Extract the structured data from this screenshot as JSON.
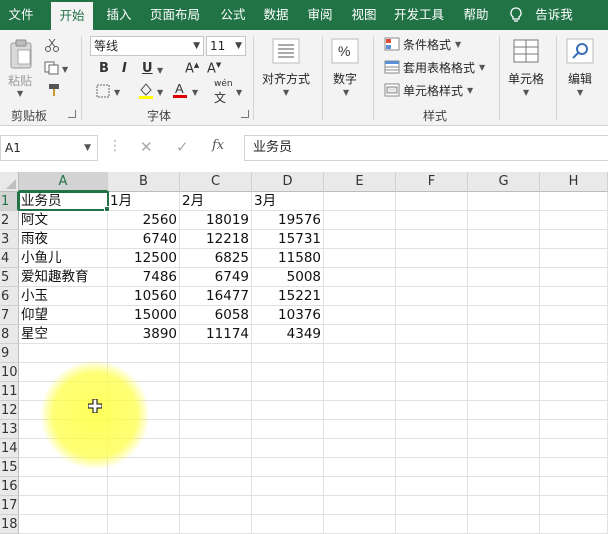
{
  "ribbon_tabs": [
    "文件",
    "开始",
    "插入",
    "页面布局",
    "公式",
    "数据",
    "审阅",
    "视图",
    "开发工具",
    "帮助",
    "告诉我"
  ],
  "active_tab": "开始",
  "clipboard": {
    "paste_label": "粘贴",
    "group_label": "剪贴板"
  },
  "font": {
    "font_name": "等线",
    "font_size": "11",
    "group_label": "字体",
    "phonetic_label": "wén"
  },
  "alignment": {
    "label": "对齐方式"
  },
  "number": {
    "label": "数字",
    "symbol": "%"
  },
  "styles": {
    "conditional_format": "条件格式",
    "table_format": "套用表格格式",
    "cell_styles": "单元格样式",
    "group_label": "样式"
  },
  "cells_group": {
    "label": "单元格"
  },
  "editing_group": {
    "label": "编辑"
  },
  "formula_bar": {
    "name_box": "A1",
    "fx": "fx",
    "content": "业务员"
  },
  "columns": [
    "A",
    "B",
    "C",
    "D",
    "E",
    "F",
    "G",
    "H"
  ],
  "rows": [
    "1",
    "2",
    "3",
    "4",
    "5",
    "6",
    "7",
    "8",
    "9",
    "10",
    "11",
    "12",
    "13",
    "14",
    "15",
    "16",
    "17",
    "18"
  ],
  "table": {
    "headers": [
      "业务员",
      "1月",
      "2月",
      "3月"
    ],
    "data": [
      [
        "阿文",
        "2560",
        "18019",
        "19576"
      ],
      [
        "雨夜",
        "6740",
        "12218",
        "15731"
      ],
      [
        "小鱼儿",
        "12500",
        "6825",
        "11580"
      ],
      [
        "爱知趣教育",
        "7486",
        "6749",
        "5008"
      ],
      [
        "小玉",
        "10560",
        "16477",
        "15221"
      ],
      [
        "仰望",
        "15000",
        "6058",
        "10376"
      ],
      [
        "星空",
        "3890",
        "11174",
        "4349"
      ]
    ]
  },
  "colors": {
    "accent": "#217346",
    "highlight": "#ffff3c"
  }
}
